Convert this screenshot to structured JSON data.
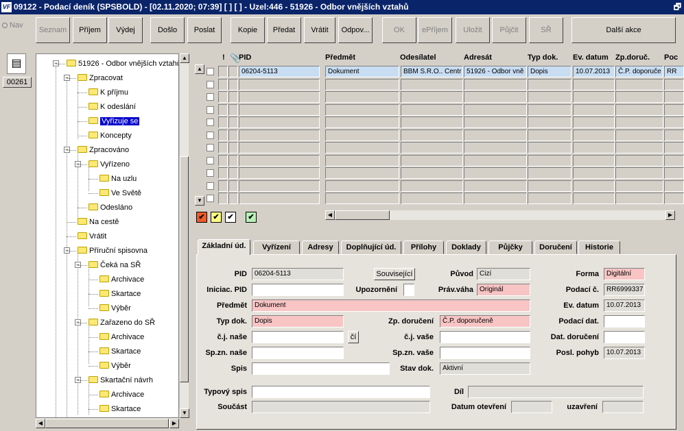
{
  "window": {
    "title": "09122 - Podací deník (SPSBOLD) - [02.11.2020; 07:39]  [ ] [ ] - Uzel:446 - 51926 - Odbor vnějších vztahů",
    "logo": "VF",
    "restore_glyph": "🗗"
  },
  "nav": {
    "label": "Nav"
  },
  "toolbar": {
    "buttons": [
      {
        "label": "Seznam",
        "enabled": false
      },
      {
        "label": "Příjem",
        "enabled": true
      },
      {
        "label": "Výdej",
        "enabled": true
      },
      {
        "label": "Došlo",
        "enabled": true
      },
      {
        "label": "Poslat",
        "enabled": true
      },
      {
        "label": "Kopie",
        "enabled": true
      },
      {
        "label": "Předat",
        "enabled": true
      },
      {
        "label": "Vrátit",
        "enabled": true
      },
      {
        "label": "Odpov...",
        "enabled": true
      },
      {
        "label": "OK",
        "enabled": false
      },
      {
        "label": "ePříjem",
        "enabled": false
      },
      {
        "label": "Uložit",
        "enabled": false
      },
      {
        "label": "Půjčit",
        "enabled": false
      },
      {
        "label": "SŘ",
        "enabled": false
      },
      {
        "label": "Další akce",
        "enabled": true
      }
    ]
  },
  "left": {
    "doc_count": "00261"
  },
  "tree": {
    "nodes": [
      {
        "label": "51926 - Odbor vnějších vztahů"
      },
      {
        "label": "Zpracovat"
      },
      {
        "label": "K příjmu"
      },
      {
        "label": "K odeslání"
      },
      {
        "label": "Vyřizuje se",
        "selected": true
      },
      {
        "label": "Koncepty"
      },
      {
        "label": "Zpracováno"
      },
      {
        "label": "Vyřízeno"
      },
      {
        "label": "Na uzlu"
      },
      {
        "label": "Ve Světě"
      },
      {
        "label": "Odesláno"
      },
      {
        "label": "Na cestě"
      },
      {
        "label": "Vrátit"
      },
      {
        "label": "Příruční spisovna"
      },
      {
        "label": "Čeká na SŘ"
      },
      {
        "label": "Archivace"
      },
      {
        "label": "Skartace"
      },
      {
        "label": "Výběr"
      },
      {
        "label": "Zařazeno do SŘ"
      },
      {
        "label": "Archivace"
      },
      {
        "label": "Skartace"
      },
      {
        "label": "Výběr"
      },
      {
        "label": "Skartační návrh"
      },
      {
        "label": "Archivace"
      },
      {
        "label": "Skartace"
      }
    ]
  },
  "grid": {
    "columns": [
      "!",
      "PID",
      "Předmět",
      "Odesílatel",
      "Adresát",
      "Typ dok.",
      "Ev. datum",
      "Zp.doruč.",
      "Poc"
    ],
    "rows": [
      {
        "pid": "06204-5113",
        "predmet": "Dokument",
        "odesilatel": "BBM S.R.O.. Centr",
        "adresat": "51926 - Odbor vně",
        "typ": "Dopis",
        "ev_datum": "10.07.2013",
        "zp_doruc": "Č.P. doporuče",
        "poc": "RR"
      }
    ]
  },
  "legend": {
    "check": "✔"
  },
  "tabs": [
    "Základní úd.",
    "Vyřízení",
    "Adresy",
    "Doplňující úd.",
    "Přílohy",
    "Doklady",
    "Půjčky",
    "Doručení",
    "Historie"
  ],
  "form": {
    "pid_label": "PID",
    "pid": "06204-5113",
    "souvisejici": "Související",
    "puvod_label": "Původ",
    "puvod": "Cizí",
    "forma_label": "Forma",
    "forma": "Digitální",
    "iniciac_label": "Iniciac. PID",
    "iniciac": "",
    "upozorneni_label": "Upozornění",
    "pravvaha_label": "Práv.váha",
    "pravvaha": "Originál",
    "podacic_label": "Podací č.",
    "podacic": "RR6999337",
    "predmet_label": "Předmět",
    "predmet": "Dokument",
    "evdatum_label": "Ev. datum",
    "evdatum": "10.07.2013",
    "typdok_label": "Typ dok.",
    "typdok": "Dopis",
    "zpdoruc_label": "Zp. doručení",
    "zpdoruc": "Č.P. doporučeně",
    "podacidat_label": "Podací dat.",
    "podacidat": "",
    "cjnase_label": "č.j. naše",
    "cjnase": "",
    "ci_btn": "čí",
    "cjvase_label": "č.j. vaše",
    "cjvase": "",
    "datdoruc_label": "Dat. doručení",
    "datdoruc": "",
    "spznnase_label": "Sp.zn. naše",
    "spznnase": "",
    "spznvase_label": "Sp.zn. vaše",
    "spznvase": "",
    "poslpohyb_label": "Posl. pohyb",
    "poslpohyb": "10.07.2013",
    "spis_label": "Spis",
    "spis": "",
    "stavdok_label": "Stav dok.",
    "stavdok": "Aktivní",
    "typovy_label": "Typový spis",
    "typovy": "",
    "dil_label": "Díl",
    "dil": "",
    "soucast_label": "Součást",
    "soucast": "",
    "datotev_label": "Datum otevření",
    "datotev": "",
    "uzavreni_label": "uzavření",
    "uzavreni": ""
  }
}
